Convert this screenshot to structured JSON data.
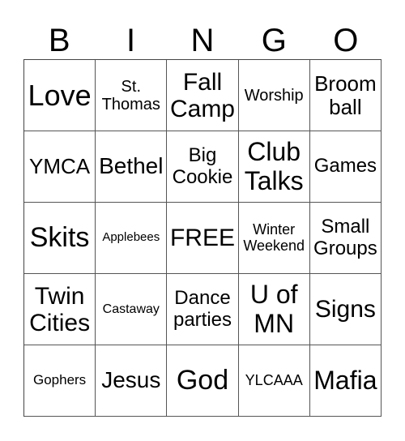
{
  "header": [
    "B",
    "I",
    "N",
    "G",
    "O"
  ],
  "rows": [
    [
      "Love",
      "St.\nThomas",
      "Fall\nCamp",
      "Worship",
      "Broom\nball"
    ],
    [
      "YMCA",
      "Bethel",
      "Big\nCookie",
      "Club\nTalks",
      "Games"
    ],
    [
      "Skits",
      "Applebees",
      "FREE",
      "Winter\nWeekend",
      "Small\nGroups"
    ],
    [
      "Twin\nCities",
      "Castaway",
      "Dance\nparties",
      "U of\nMN",
      "Signs"
    ],
    [
      "Gophers",
      "Jesus",
      "God",
      "YLCAAA",
      "Mafia"
    ]
  ]
}
